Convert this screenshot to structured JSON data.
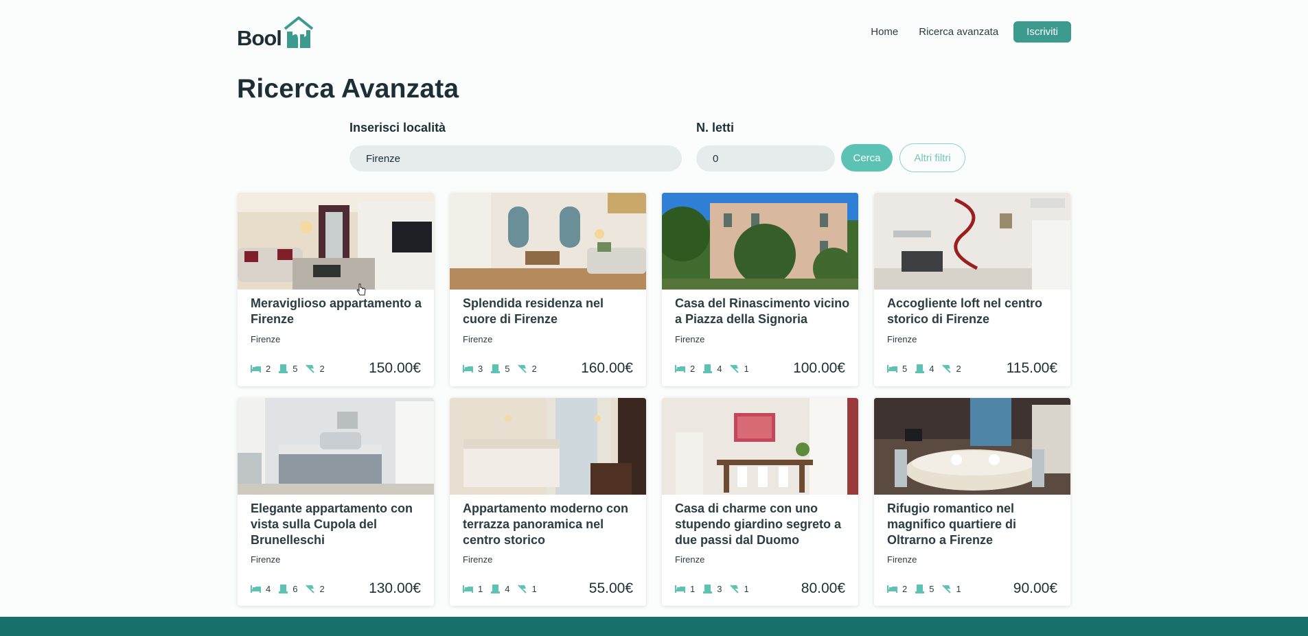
{
  "header": {
    "logo_text": "Bool",
    "nav": {
      "home": "Home",
      "advanced": "Ricerca avanzata",
      "signup": "Iscriviti"
    }
  },
  "page_title": "Ricerca Avanzata",
  "search": {
    "location_label": "Inserisci località",
    "location_value": "Firenze",
    "beds_label": "N. letti",
    "beds_value": "0",
    "search_button": "Cerca",
    "filters_button": "Altri filtri"
  },
  "colors": {
    "accent": "#3d9a8e",
    "accent_light": "#5cc3b4",
    "footer": "#17706b"
  },
  "icons": {
    "beds": "bed-icon",
    "rooms": "room-icon",
    "baths": "bath-icon"
  },
  "listings": [
    {
      "title": "Meraviglioso appartamento a Firenze",
      "city": "Firenze",
      "beds": "2",
      "rooms": "5",
      "baths": "2",
      "price": "150.00€"
    },
    {
      "title": "Splendida residenza nel cuore di Firenze",
      "city": "Firenze",
      "beds": "3",
      "rooms": "5",
      "baths": "2",
      "price": "160.00€"
    },
    {
      "title": "Casa del Rinascimento vicino a Piazza della Signoria",
      "city": "Firenze",
      "beds": "2",
      "rooms": "4",
      "baths": "1",
      "price": "100.00€"
    },
    {
      "title": "Accogliente loft nel centro storico di Firenze",
      "city": "Firenze",
      "beds": "5",
      "rooms": "4",
      "baths": "2",
      "price": "115.00€"
    },
    {
      "title": "Elegante appartamento con vista sulla Cupola del Brunelleschi",
      "city": "Firenze",
      "beds": "4",
      "rooms": "6",
      "baths": "2",
      "price": "130.00€"
    },
    {
      "title": "Appartamento moderno con terrazza panoramica nel centro storico",
      "city": "Firenze",
      "beds": "1",
      "rooms": "4",
      "baths": "1",
      "price": "55.00€"
    },
    {
      "title": "Casa di charme con uno stupendo giardino segreto a due passi dal Duomo",
      "city": "Firenze",
      "beds": "1",
      "rooms": "3",
      "baths": "1",
      "price": "80.00€"
    },
    {
      "title": "Rifugio romantico nel magnifico quartiere di Oltrarno a Firenze",
      "city": "Firenze",
      "beds": "2",
      "rooms": "5",
      "baths": "1",
      "price": "90.00€"
    }
  ]
}
